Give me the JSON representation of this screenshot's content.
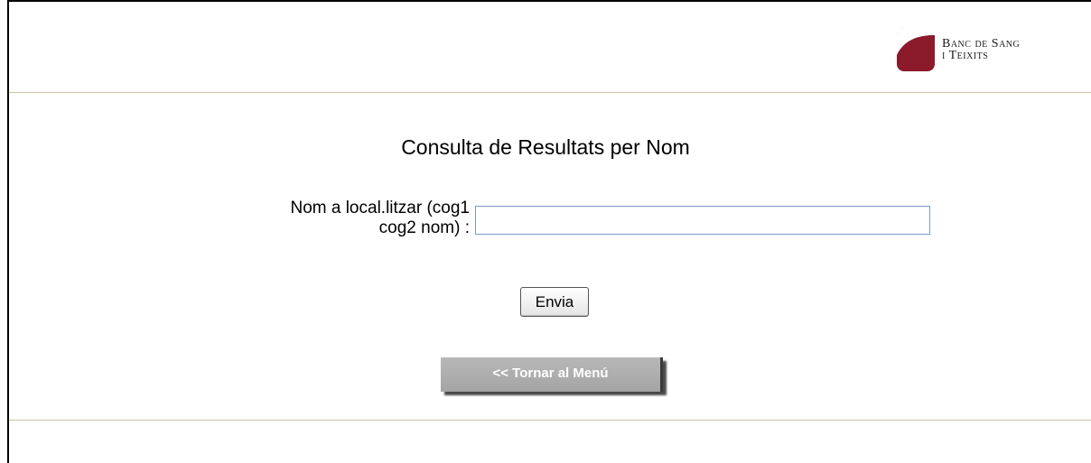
{
  "logo": {
    "line1": "Banc de Sang",
    "line2": "i Teixits",
    "icon": "banc-de-sang-logo",
    "color": "#8b1a2b"
  },
  "main": {
    "title": "Consulta de Resultats per Nom",
    "field_label_line1": "Nom a local.litzar (cog1",
    "field_label_line2": "cog2 nom) :",
    "field_value": "",
    "submit_label": "Envia",
    "back_label": "<< Tornar al Menú"
  },
  "colors": {
    "divider": "#c9c4a8",
    "input_border": "#7a9cc4",
    "back_button": "#a8a8a8"
  }
}
